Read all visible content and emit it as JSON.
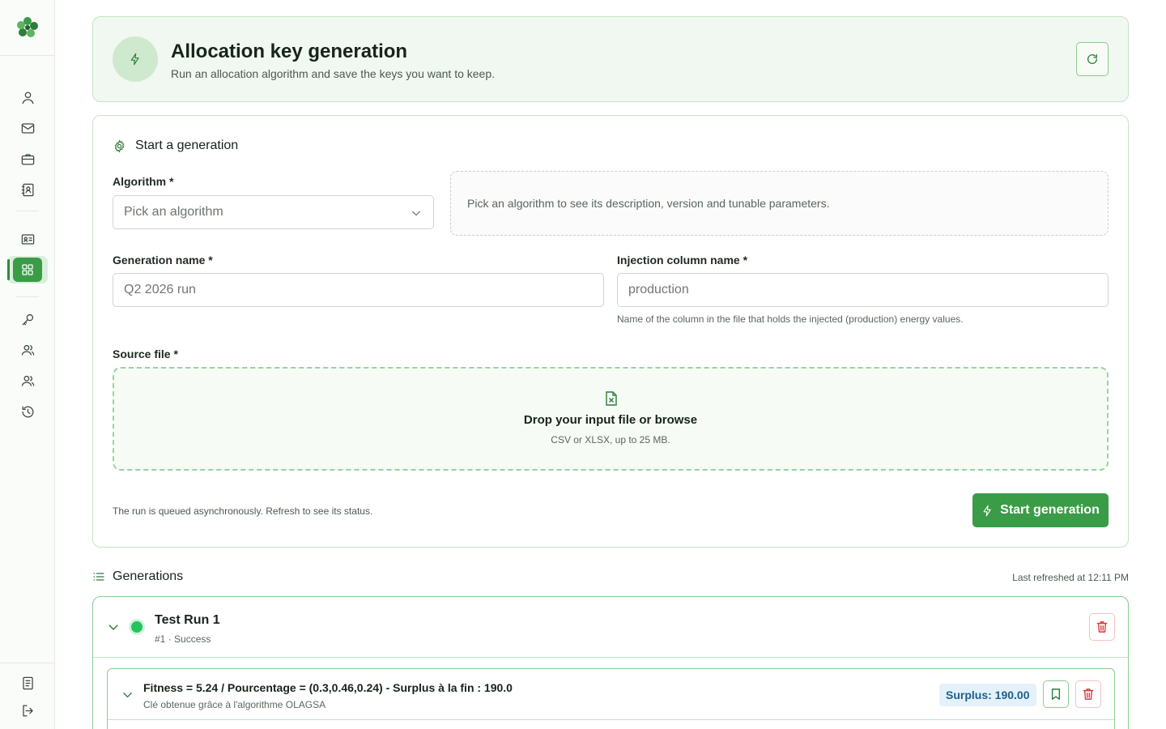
{
  "sidebar": {
    "logo_icon": "clover-logo-icon",
    "items": [
      {
        "icon": "user-icon"
      },
      {
        "icon": "mail-icon"
      },
      {
        "icon": "briefcase-icon"
      },
      {
        "icon": "contact-book-icon"
      },
      {
        "icon": "id-card-icon"
      },
      {
        "icon": "grid-icon",
        "active": true
      },
      {
        "icon": "key-icon"
      },
      {
        "icon": "users-icon"
      },
      {
        "icon": "team-icon"
      },
      {
        "icon": "history-icon"
      }
    ],
    "bottom": [
      {
        "icon": "document-icon"
      },
      {
        "icon": "logout-icon"
      }
    ]
  },
  "header": {
    "title": "Allocation key generation",
    "subtitle": "Run an allocation algorithm and save the keys you want to keep.",
    "badge_icon": "lightning-icon",
    "refresh_icon": "refresh-icon"
  },
  "form": {
    "section_title": "Start a generation",
    "section_icon": "gear-icon",
    "algorithm_label": "Algorithm *",
    "algorithm_placeholder": "Pick an algorithm",
    "algorithm_hint": "Pick an algorithm to see its description, version and tunable parameters.",
    "generation_name_label": "Generation name *",
    "generation_name_placeholder": "Q2 2026 run",
    "injection_label": "Injection column name *",
    "injection_placeholder": "production",
    "injection_helper": "Name of the column in the file that holds the injected (production) energy values.",
    "source_file_label": "Source file *",
    "dropzone_icon": "spreadsheet-file-icon",
    "dropzone_title": "Drop your input file or browse",
    "dropzone_sub": "CSV or XLSX, up to 25 MB.",
    "footnote": "The run is queued asynchronously. Refresh to see its status.",
    "start_label": "Start generation"
  },
  "generations": {
    "title": "Generations",
    "title_icon": "list-icon",
    "last_refreshed": "Last refreshed at 12:11 PM",
    "runs": [
      {
        "name": "Test Run 1",
        "meta": "#1 · Success",
        "status_color": "#22c55e",
        "keys": [
          {
            "title": "Fitness = 5.24 / Pourcentage = (0.3,0.46,0.24) - Surplus à la fin : 190.0",
            "subtitle": "Clé obtenue grâce à l'algorithme OLAGSA",
            "surplus": "Surplus: 190.00"
          }
        ]
      }
    ]
  },
  "colors": {
    "accent": "#3a9c47",
    "accent_light": "#f1f8f1",
    "border_green": "#c5e3c5",
    "danger": "#dc3b3b",
    "info_badge": "#e3f1fb"
  }
}
